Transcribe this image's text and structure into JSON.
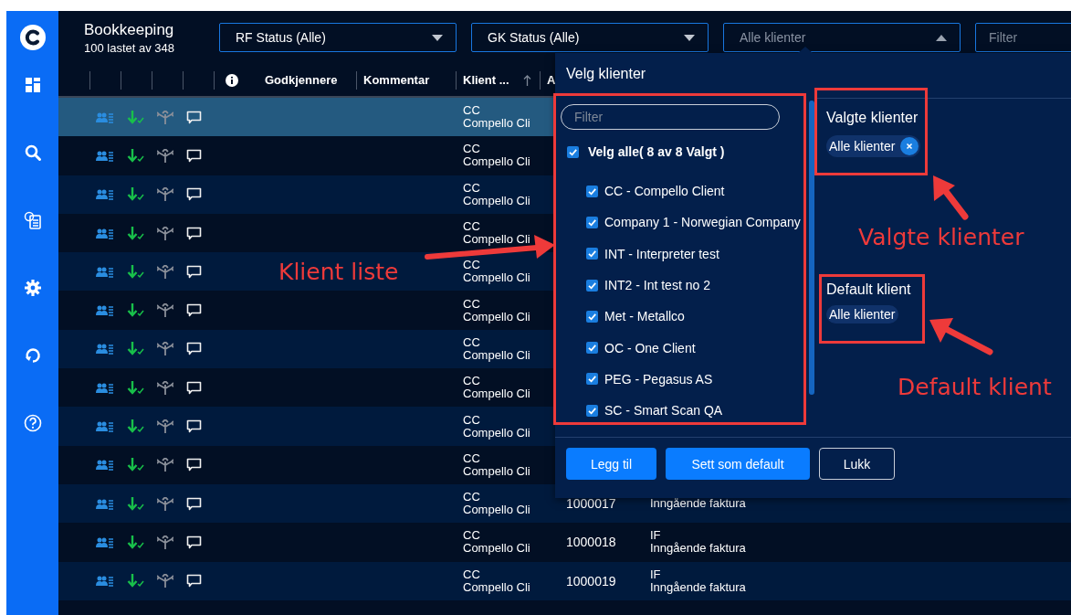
{
  "sidebar": {
    "items": [
      {
        "kind": "dashboard"
      },
      {
        "kind": "search"
      },
      {
        "kind": "document"
      },
      {
        "kind": "settings"
      },
      {
        "kind": "refresh"
      },
      {
        "kind": "help"
      }
    ]
  },
  "header": {
    "title": "Bookkeeping",
    "subtitle": "100 lastet av 348",
    "filters": [
      {
        "kind": "dropdown",
        "value": "RF Status (Alle)",
        "open": false
      },
      {
        "kind": "dropdown",
        "value": "GK Status (Alle)",
        "open": false
      },
      {
        "kind": "dropdown",
        "placeholder": "Alle klienter",
        "open": true
      },
      {
        "kind": "input",
        "placeholder": "Filter"
      }
    ]
  },
  "table": {
    "columns": [
      {
        "kind": "blank"
      },
      {
        "kind": "blank"
      },
      {
        "kind": "blank"
      },
      {
        "kind": "blank"
      },
      {
        "kind": "info"
      },
      {
        "kind": "text",
        "label": "Godkjennere"
      },
      {
        "kind": "text",
        "label": "Kommentar"
      },
      {
        "kind": "text",
        "label": "Klient ...",
        "sorted_ascending": true
      },
      {
        "kind": "text",
        "label": "A"
      }
    ],
    "rows": [
      {
        "selected": true,
        "client_code": "CC",
        "client_name": "Compello Cli"
      },
      {
        "selected": false,
        "client_code": "CC",
        "client_name": "Compello Cli"
      },
      {
        "selected": false,
        "client_code": "CC",
        "client_name": "Compello Cli"
      },
      {
        "selected": false,
        "client_code": "CC",
        "client_name": "Compello Cli"
      },
      {
        "selected": false,
        "client_code": "CC",
        "client_name": "Compello Cli"
      },
      {
        "selected": false,
        "client_code": "CC",
        "client_name": "Compello Cli"
      },
      {
        "selected": false,
        "client_code": "CC",
        "client_name": "Compello Cli"
      },
      {
        "selected": false,
        "client_code": "CC",
        "client_name": "Compello Cli"
      },
      {
        "selected": false,
        "client_code": "CC",
        "client_name": "Compello Cli"
      },
      {
        "selected": false,
        "client_code": "CC",
        "client_name": "Compello Cli"
      },
      {
        "selected": false,
        "client_code": "CC",
        "client_name": "Compello Cli",
        "number": "1000017",
        "doc_name": "Inngående faktura"
      },
      {
        "selected": false,
        "client_code": "CC",
        "client_name": "Compello Cli",
        "number": "1000018",
        "doc_code": "IF",
        "doc_name": "Inngående faktura"
      },
      {
        "selected": false,
        "client_code": "CC",
        "client_name": "Compello Cli",
        "number": "1000019",
        "doc_code": "IF",
        "doc_name": "Inngående faktura"
      }
    ]
  },
  "client_picker": {
    "title": "Velg klienter",
    "filter": {
      "placeholder": "Filter"
    },
    "select_all": {
      "label": "Velg alle( 8 av 8 Valgt )",
      "checked": true
    },
    "clients": [
      {
        "label": "CC - Compello Client",
        "checked": true
      },
      {
        "label": "Company 1 - Norwegian Company",
        "checked": true
      },
      {
        "label": "INT - Interpreter test",
        "checked": true
      },
      {
        "label": "INT2 - Int test no 2",
        "checked": true
      },
      {
        "label": "Met - Metallco",
        "checked": true
      },
      {
        "label": "OC - One Client",
        "checked": true
      },
      {
        "label": "PEG - Pegasus AS",
        "checked": true
      },
      {
        "label": "SC - Smart Scan QA",
        "checked": true
      }
    ],
    "sections": [
      {
        "heading": "Valgte klienter",
        "chips": [
          {
            "label": "Alle klienter",
            "removable": true
          }
        ]
      },
      {
        "heading": "Default klient",
        "chips": [
          {
            "label": "Alle klienter",
            "removable": false
          }
        ]
      }
    ],
    "buttons": [
      {
        "label": "Legg til",
        "kind": "primary"
      },
      {
        "label": "Sett som default",
        "kind": "primary"
      },
      {
        "label": "Lukk",
        "kind": "secondary"
      }
    ]
  },
  "annotations": [
    {
      "label": "Klient liste"
    },
    {
      "label": "Valgte klienter"
    },
    {
      "label": "Default klient"
    }
  ]
}
